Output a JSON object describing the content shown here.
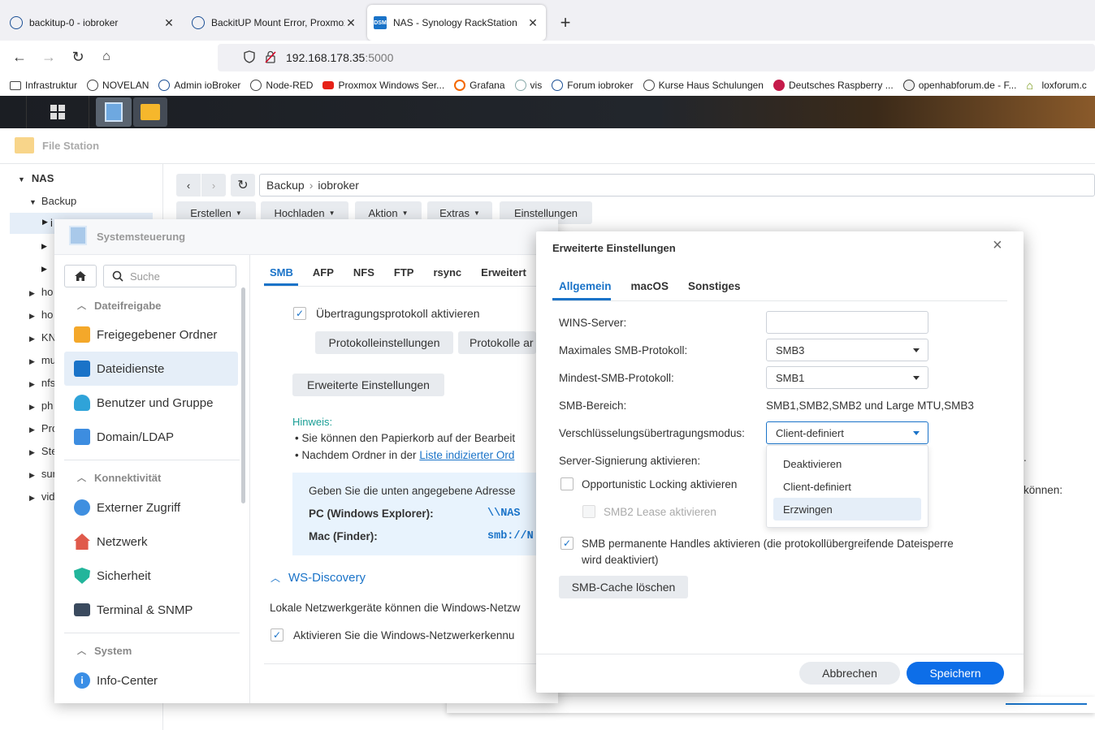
{
  "browser": {
    "tabs": [
      {
        "title": "backitup-0 - iobroker"
      },
      {
        "title": "BackitUP Mount Error, Proxmox"
      },
      {
        "title": "NAS - Synology RackStation"
      }
    ],
    "new_tab": "+",
    "url_host": "192.168.178.35",
    "url_port": ":5000",
    "bookmarks": [
      {
        "label": "Infrastruktur"
      },
      {
        "label": "NOVELAN"
      },
      {
        "label": "Admin ioBroker"
      },
      {
        "label": "Node-RED"
      },
      {
        "label": "Proxmox Windows Ser..."
      },
      {
        "label": "Grafana"
      },
      {
        "label": "vis"
      },
      {
        "label": "Forum iobroker"
      },
      {
        "label": "Kurse Haus Schulungen"
      },
      {
        "label": "Deutsches Raspberry ..."
      },
      {
        "label": "openhabforum.de - F..."
      },
      {
        "label": "loxforum.c"
      }
    ]
  },
  "filestation": {
    "title": "File Station",
    "tree": {
      "root": "NAS",
      "backup": "Backup",
      "items": [
        "ho",
        "ho",
        "KN",
        "mu",
        "nfs",
        "ph",
        "Pro",
        "Ste",
        "sur",
        "vid"
      ]
    },
    "path": [
      "Backup",
      "iobroker"
    ],
    "toolbar": {
      "create": "Erstellen",
      "upload": "Hochladen",
      "action": "Aktion",
      "extras": "Extras",
      "settings": "Einstellungen"
    }
  },
  "syscontrol": {
    "title": "Systemsteuerung",
    "search_placeholder": "Suche",
    "section_fileshare": "Dateifreigabe",
    "section_connectivity": "Konnektivität",
    "section_system": "System",
    "items": {
      "shared_folder": "Freigegebener Ordner",
      "file_services": "Dateidienste",
      "users_groups": "Benutzer und Gruppe",
      "domain_ldap": "Domain/LDAP",
      "external_access": "Externer Zugriff",
      "network": "Netzwerk",
      "security": "Sicherheit",
      "terminal": "Terminal & SNMP",
      "info_center": "Info-Center"
    },
    "tabs": [
      "SMB",
      "AFP",
      "NFS",
      "FTP",
      "rsync",
      "Erweitert"
    ],
    "enable_protocol": "Übertragungsprotokoll aktivieren",
    "protocol_settings": "Protokolleinstellungen",
    "protocols_btn": "Protokolle ar",
    "advanced_settings": "Erweiterte Einstellungen",
    "hint_title": "Hinweis:",
    "hint_1": "Sie können den Papierkorb auf der Bearbeit",
    "hint_2_prefix": "Nachdem Ordner in der",
    "hint_2_link": "Liste indizierter Ord",
    "info_text": "Geben Sie die unten angegebene Adresse",
    "info_tail": "können:",
    "pc_label": "PC (Windows Explorer):",
    "pc_value": "\\\\NAS",
    "mac_label": "Mac (Finder):",
    "mac_value": "smb://N",
    "ws_discovery": "WS-Discovery",
    "ws_text": "Lokale Netzwerkgeräte können die Windows-Netzw",
    "ws_check": "Aktivieren Sie die Windows-Netzwerkerkennu"
  },
  "dialog": {
    "title": "Erweiterte Einstellungen",
    "close": "×",
    "tabs": [
      "Allgemein",
      "macOS",
      "Sonstiges"
    ],
    "wins_label": "WINS-Server:",
    "wins_value": "",
    "max_smb_label": "Maximales SMB-Protokoll:",
    "max_smb_value": "SMB3",
    "min_smb_label": "Mindest-SMB-Protokoll:",
    "min_smb_value": "SMB1",
    "range_label": "SMB-Bereich:",
    "range_value": "SMB1,SMB2,SMB2 und Large MTU,SMB3",
    "enc_label": "Verschlüsselungsübertragungsmodus:",
    "enc_value": "Client-definiert",
    "enc_options": [
      "Deaktivieren",
      "Client-definiert",
      "Erzwingen"
    ],
    "signing_label": "Server-Signierung aktivieren:",
    "oplock_label": "Opportunistic Locking aktivieren",
    "lease_label": "SMB2 Lease aktivieren",
    "durable_label_1": "SMB permanente Handles aktivieren (die protokollübergreifende Dateisperre",
    "durable_label_2": "wird deaktiviert)",
    "clear_cache": "SMB-Cache löschen",
    "cancel": "Abbrechen",
    "save": "Speichern"
  },
  "colors": {
    "accent": "#1a73c8",
    "primary_button": "#0d6ee8",
    "selected_bg": "#e5eef8",
    "info_bg": "#e8f3fd"
  }
}
